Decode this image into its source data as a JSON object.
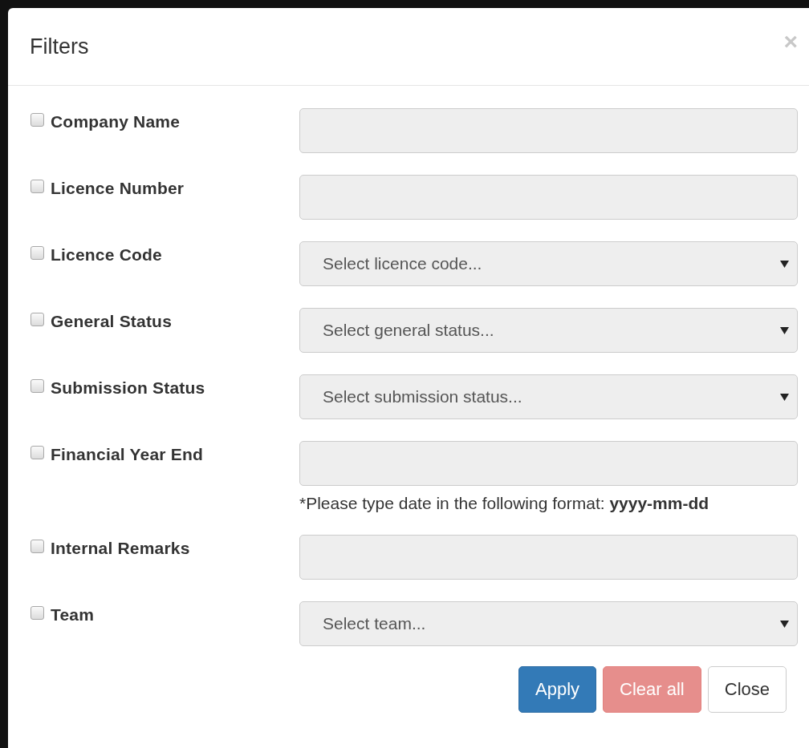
{
  "dialog": {
    "title": "Filters",
    "close_glyph": "×"
  },
  "filters": [
    {
      "label": "Company Name",
      "checked": false,
      "kind": "text"
    },
    {
      "label": "Licence Number",
      "checked": false,
      "kind": "text"
    },
    {
      "label": "Licence Code",
      "checked": false,
      "kind": "select",
      "placeholder": "Select licence code..."
    },
    {
      "label": "General Status",
      "checked": false,
      "kind": "select",
      "placeholder": "Select general status..."
    },
    {
      "label": "Submission Status",
      "checked": false,
      "kind": "select",
      "placeholder": "Select submission status..."
    },
    {
      "label": "Financial Year End",
      "checked": false,
      "kind": "text",
      "help": "*Please type date in the following format: **yyyy-mm-dd**"
    },
    {
      "label": "Internal Remarks",
      "checked": false,
      "kind": "text"
    },
    {
      "label": "Team",
      "checked": false,
      "kind": "select",
      "placeholder": "Select team..."
    }
  ],
  "buttons": [
    {
      "label": "Apply",
      "kind": "primary",
      "disabled": false
    },
    {
      "label": "Clear all",
      "kind": "danger",
      "disabled": true
    },
    {
      "label": "Close",
      "kind": "default",
      "disabled": false
    }
  ]
}
